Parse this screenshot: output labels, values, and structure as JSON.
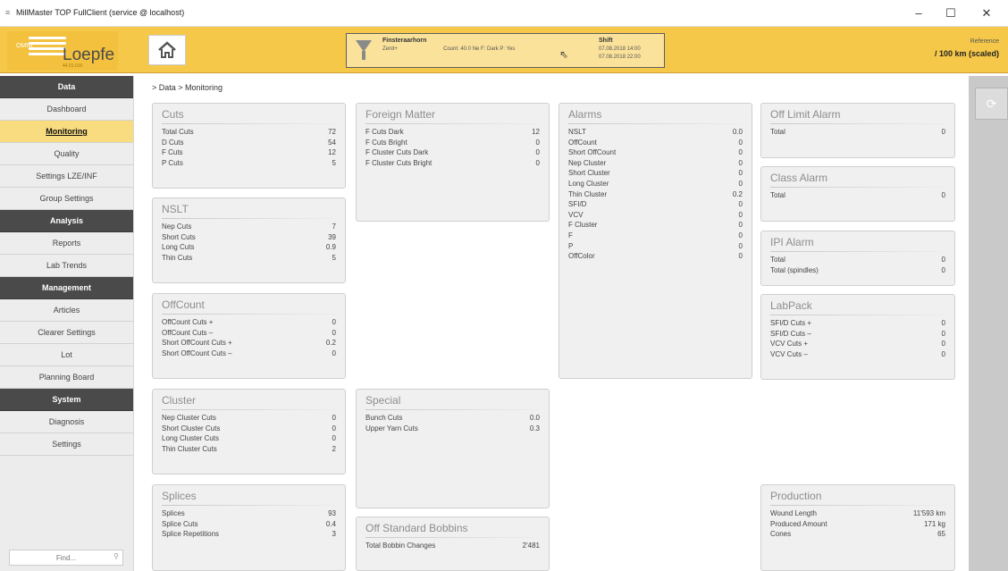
{
  "window": {
    "title": "MillMaster TOP FullClient (service @ localhost)",
    "minimize": "–",
    "maximize": "☐",
    "close": "✕"
  },
  "header": {
    "logo_text": "Loepfe",
    "logo_sub": "OMNI",
    "logo_version": "44.01.016",
    "filter": {
      "title": "Finsteraarhorn",
      "sub": "Zenit+",
      "count": "Count: 40.0 Ne F: Dark P: Yes"
    },
    "shift": {
      "title": "Shift",
      "from": "07.08.2018 14:00",
      "to": "07.08.2018 22:00"
    },
    "reference_label": "Reference",
    "reference_value": "/ 100 km (scaled)"
  },
  "sidebar": {
    "groups": [
      {
        "head": "Data",
        "items": [
          "Dashboard",
          "Monitoring",
          "Quality",
          "Settings LZE/INF",
          "Group Settings"
        ]
      },
      {
        "head": "Analysis",
        "items": [
          "Reports",
          "Lab Trends"
        ]
      },
      {
        "head": "Management",
        "items": [
          "Articles",
          "Clearer Settings",
          "Lot",
          "Planning Board"
        ]
      },
      {
        "head": "System",
        "items": [
          "Diagnosis",
          "Settings"
        ]
      }
    ],
    "active": "Monitoring",
    "find_placeholder": "Find..."
  },
  "breadcrumb": "> Data > Monitoring",
  "panels": {
    "cuts": {
      "title": "Cuts",
      "rows": [
        [
          "Total Cuts",
          "72"
        ],
        [
          "D Cuts",
          "54"
        ],
        [
          "F Cuts",
          "12"
        ],
        [
          "P Cuts",
          "5"
        ]
      ]
    },
    "nslt": {
      "title": "NSLT",
      "rows": [
        [
          "Nep Cuts",
          "7"
        ],
        [
          "Short Cuts",
          "39"
        ],
        [
          "Long Cuts",
          "0.9"
        ],
        [
          "Thin Cuts",
          "5"
        ]
      ]
    },
    "offcount": {
      "title": "OffCount",
      "rows": [
        [
          "OffCount Cuts +",
          "0"
        ],
        [
          "OffCount Cuts –",
          "0"
        ],
        [
          "Short OffCount Cuts +",
          "0.2"
        ],
        [
          "Short OffCount Cuts –",
          "0"
        ]
      ]
    },
    "cluster": {
      "title": "Cluster",
      "rows": [
        [
          "Nep Cluster Cuts",
          "0"
        ],
        [
          "Short Cluster Cuts",
          "0"
        ],
        [
          "Long Cluster Cuts",
          "0"
        ],
        [
          "Thin Cluster Cuts",
          "2"
        ]
      ]
    },
    "splices": {
      "title": "Splices",
      "rows": [
        [
          "Splices",
          "93"
        ],
        [
          "Splice Cuts",
          "0.4"
        ],
        [
          "Splice Repetitions",
          "3"
        ]
      ]
    },
    "foreign": {
      "title": "Foreign Matter",
      "rows": [
        [
          "F Cuts Dark",
          "12"
        ],
        [
          "F Cuts Bright",
          "0"
        ],
        [
          "F Cluster Cuts Dark",
          "0"
        ],
        [
          "F Cluster Cuts Bright",
          "0"
        ]
      ]
    },
    "special": {
      "title": "Special",
      "rows": [
        [
          "Bunch Cuts",
          "0.0"
        ],
        [
          "Upper Yarn Cuts",
          "0.3"
        ]
      ]
    },
    "bobbins": {
      "title": "Off Standard Bobbins",
      "rows": [
        [
          "Total Bobbin Changes",
          "2'481"
        ]
      ]
    },
    "alarms": {
      "title": "Alarms",
      "rows": [
        [
          "NSLT",
          "0.0"
        ],
        [
          "OffCount",
          "0"
        ],
        [
          "Short OffCount",
          "0"
        ],
        [
          "Nep Cluster",
          "0"
        ],
        [
          "Short Cluster",
          "0"
        ],
        [
          "Long Cluster",
          "0"
        ],
        [
          "Thin Cluster",
          "0.2"
        ],
        [
          "SFI/D",
          "0"
        ],
        [
          "VCV",
          "0"
        ],
        [
          "F Cluster",
          "0"
        ],
        [
          "F",
          "0"
        ],
        [
          "P",
          "0"
        ],
        [
          "OffColor",
          "0"
        ]
      ]
    },
    "offlimit": {
      "title": "Off Limit Alarm",
      "rows": [
        [
          "Total",
          "0"
        ]
      ]
    },
    "classalarm": {
      "title": "Class Alarm",
      "rows": [
        [
          "Total",
          "0"
        ]
      ]
    },
    "ipialarm": {
      "title": "IPI Alarm",
      "rows": [
        [
          "Total",
          "0"
        ],
        [
          "Total (spindles)",
          "0"
        ]
      ]
    },
    "labpack": {
      "title": "LabPack",
      "rows": [
        [
          "SFI/D Cuts +",
          "0"
        ],
        [
          "SFI/D Cuts –",
          "0"
        ],
        [
          "VCV Cuts +",
          "0"
        ],
        [
          "VCV Cuts –",
          "0"
        ]
      ]
    },
    "production": {
      "title": "Production",
      "rows": [
        [
          "Wound Length",
          "11'593 km"
        ],
        [
          "Produced Amount",
          "171 kg"
        ],
        [
          "Cones",
          "65"
        ]
      ]
    }
  }
}
